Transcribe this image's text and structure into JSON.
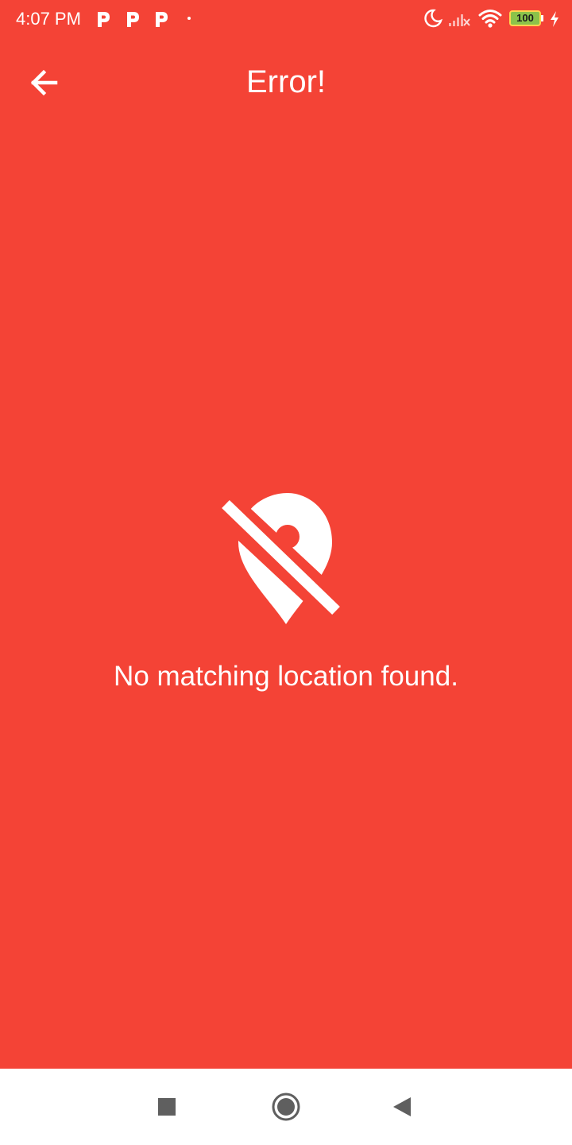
{
  "status_bar": {
    "time": "4:07 PM",
    "notification_icons": [
      "p-app-icon",
      "p-app-icon",
      "p-app-icon",
      "dot-icon"
    ],
    "battery": "100",
    "right_icons": [
      "moon-icon",
      "signal-icon",
      "wifi-icon",
      "battery-icon",
      "charging-icon"
    ]
  },
  "app_bar": {
    "back_icon": "arrow-back-icon",
    "title": "Error!"
  },
  "content": {
    "icon": "location-off-icon",
    "message": "No matching location found."
  },
  "nav_bar": {
    "buttons": [
      "recents-button",
      "home-button",
      "back-button"
    ]
  },
  "colors": {
    "background": "#F44336",
    "foreground": "#FFFFFF",
    "nav_background": "#FFFFFF",
    "nav_icon": "#5F5F5F",
    "battery_fill": "#8BC34A",
    "battery_border": "#FFD54F"
  }
}
